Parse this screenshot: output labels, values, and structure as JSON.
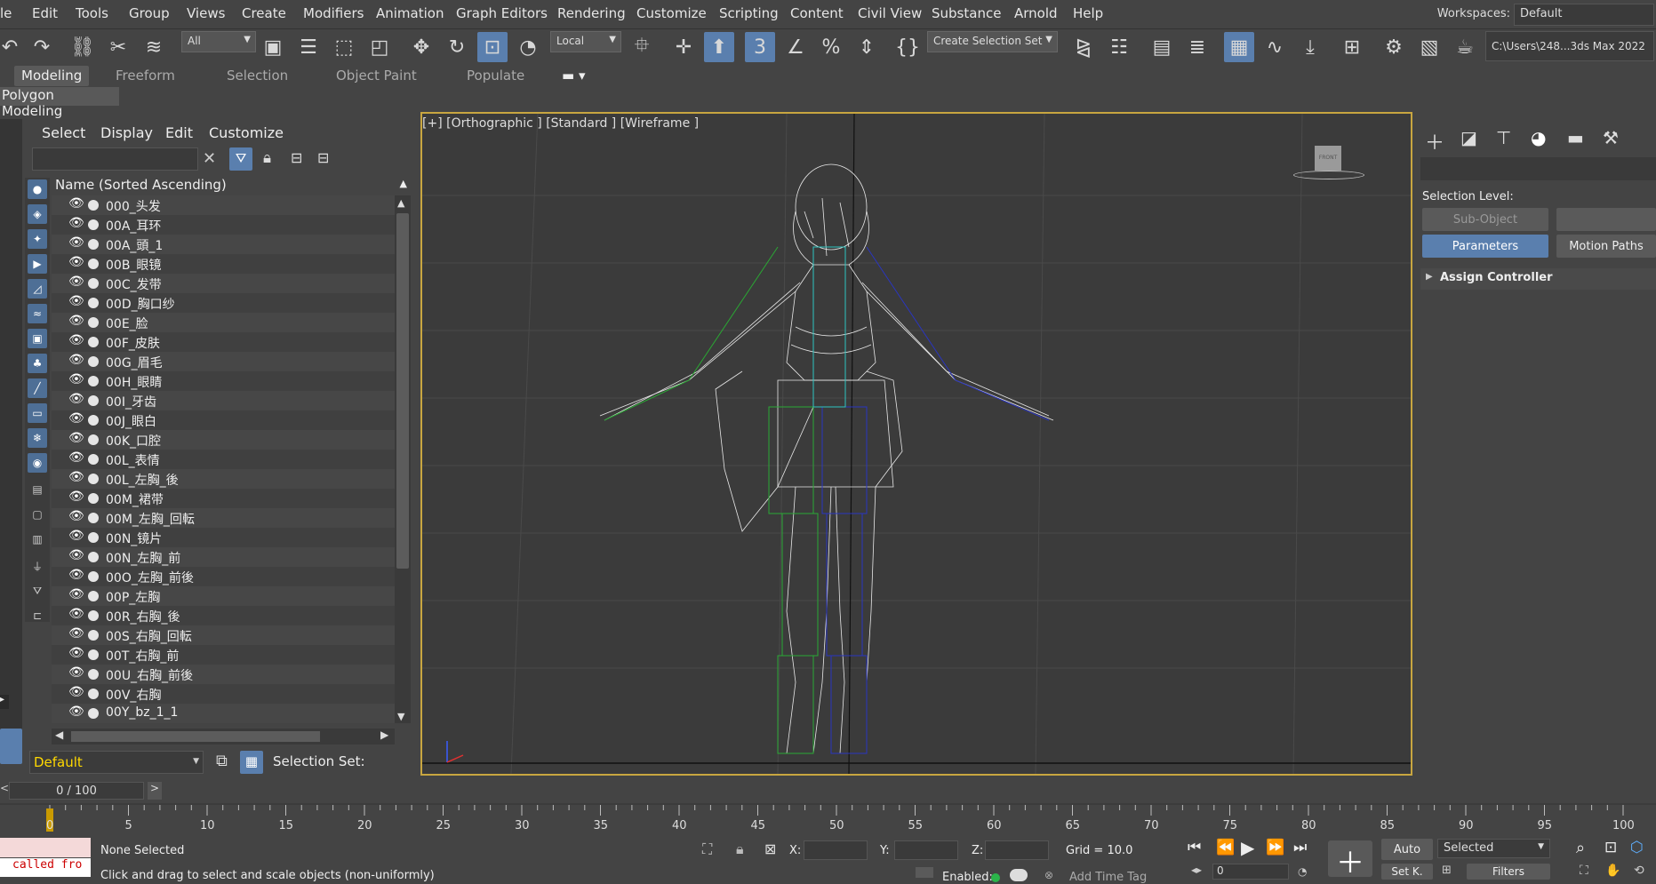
{
  "menubar": {
    "items": [
      "le",
      "Edit",
      "Tools",
      "Group",
      "Views",
      "Create",
      "Modifiers",
      "Animation",
      "Graph Editors",
      "Rendering",
      "Customize",
      "Scripting",
      "Content",
      "Civil View",
      "Substance",
      "Arnold",
      "Help"
    ],
    "workspaces_label": "Workspaces:",
    "workspaces_value": "Default"
  },
  "toolbar": {
    "filter_value": "All",
    "coord_value": "Local",
    "selection_set_value": "Create Selection Set",
    "path_text": "C:\\Users\\248...3ds Max 2022"
  },
  "ribbon": {
    "tabs": [
      "Modeling",
      "Freeform",
      "Selection",
      "Object Paint",
      "Populate"
    ],
    "active": "Modeling",
    "sub_label": "Polygon Modeling"
  },
  "explorer": {
    "menu": [
      "Select",
      "Display",
      "Edit",
      "Customize"
    ],
    "column_header": "Name (Sorted Ascending)",
    "rows": [
      "000_头发",
      "00A_耳环",
      "00A_頭_1",
      "00B_眼镜",
      "00C_发带",
      "00D_胸口纱",
      "00E_脸",
      "00F_皮肤",
      "00G_眉毛",
      "00H_眼睛",
      "00I_牙齿",
      "00J_眼白",
      "00K_口腔",
      "00L_表情",
      "00L_左胸_後",
      "00M_裙带",
      "00M_左胸_回転",
      "00N_镜片",
      "00N_左胸_前",
      "00O_左胸_前後",
      "00P_左胸",
      "00R_右胸_後",
      "00S_右胸_回転",
      "00T_右胸_前",
      "00U_右胸_前後",
      "00V_右胸",
      "00Y_bz_1_1"
    ],
    "layer_value": "Default",
    "selection_set_label": "Selection Set:"
  },
  "viewport": {
    "label": "[+] [Orthographic ] [Standard ] [Wireframe ]",
    "viewcube_label": "FRONT"
  },
  "command_panel": {
    "selection_level_label": "Selection Level:",
    "sub_object_label": "Sub-Object",
    "parameters_label": "Parameters",
    "motion_paths_label": "Motion Paths",
    "assign_controller_label": "Assign Controller"
  },
  "timeline": {
    "frame_counter": "0 / 100",
    "ticks": [
      "0",
      "5",
      "10",
      "15",
      "20",
      "25",
      "30",
      "35",
      "40",
      "45",
      "50",
      "55",
      "60",
      "65",
      "70",
      "75",
      "80",
      "85",
      "90",
      "95",
      "100"
    ]
  },
  "status": {
    "script_text": "called fro",
    "selection_status": "None Selected",
    "hint": "Click and drag to select and scale objects (non-uniformly)",
    "x_label": "X:",
    "y_label": "Y:",
    "z_label": "Z:",
    "grid_text": "Grid = 10.0",
    "auto_label": "Auto",
    "setkey_label": "Set K.",
    "key_filter_value": "Selected",
    "filters_label": "Filters",
    "enabled_label": "Enabled:",
    "add_time_tag": "Add Time Tag",
    "frame_value": "0"
  },
  "colors": {
    "accent": "#5a7fae",
    "viewport_border": "#c8a640",
    "layer_text": "#ffd800"
  }
}
